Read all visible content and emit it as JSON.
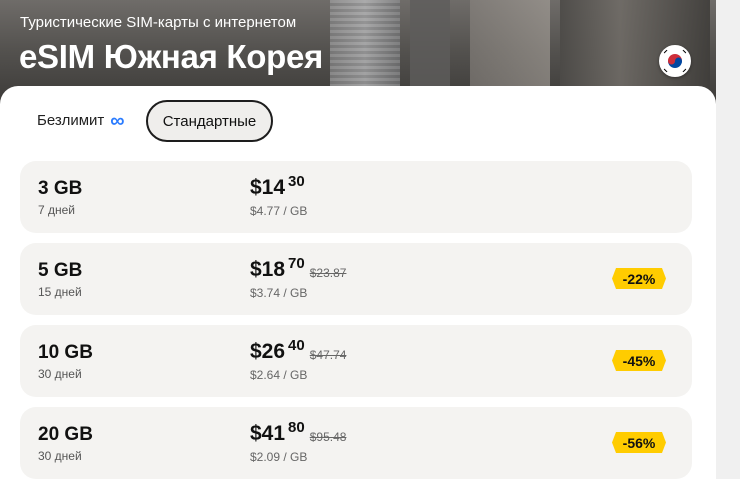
{
  "header": {
    "subtitle": "Туристические SIM-карты с интернетом",
    "title": "eSIM Южная Корея"
  },
  "tabs": {
    "unlimited_label": "Безлимит",
    "unlimited_icon": "infinity-icon",
    "standard_label": "Стандартные"
  },
  "plans": [
    {
      "data": "3 GB",
      "days": "7 дней",
      "price_main": "$14",
      "price_cents": "30",
      "old_price": "",
      "per_gb": "$4.77 / GB",
      "discount": ""
    },
    {
      "data": "5 GB",
      "days": "15 дней",
      "price_main": "$18",
      "price_cents": "70",
      "old_price": "$23.87",
      "per_gb": "$3.74 / GB",
      "discount": "-22%"
    },
    {
      "data": "10 GB",
      "days": "30 дней",
      "price_main": "$26",
      "price_cents": "40",
      "old_price": "$47.74",
      "per_gb": "$2.64 / GB",
      "discount": "-45%"
    },
    {
      "data": "20 GB",
      "days": "30 дней",
      "price_main": "$41",
      "price_cents": "80",
      "old_price": "$95.48",
      "per_gb": "$2.09 / GB",
      "discount": "-56%"
    }
  ],
  "colors": {
    "badge": "#ffcc00",
    "accent_infinity": "#2b7cff",
    "card_bg": "#f4f3f1"
  }
}
